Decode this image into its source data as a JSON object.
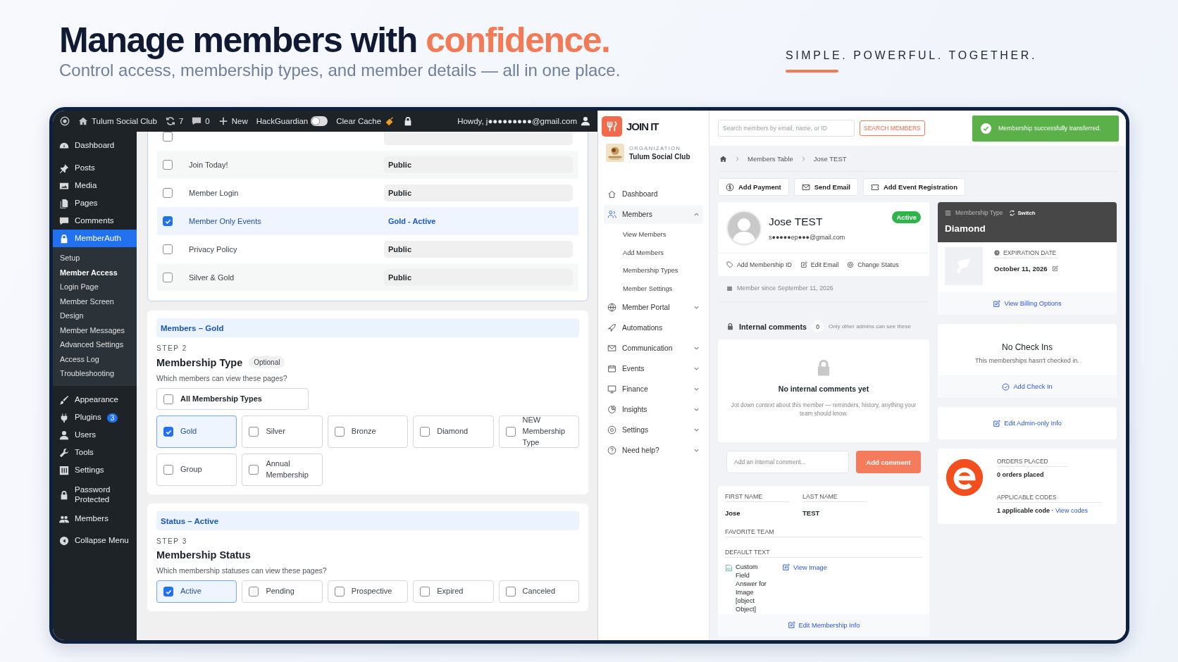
{
  "hero": {
    "title": "Manage members with ",
    "title_accent": "confidence.",
    "subtitle": "Control access, membership types, and member details — all in one place.",
    "tagline": "SIMPLE. POWERFUL. TOGETHER."
  },
  "wp": {
    "admin_bar": {
      "site": "Tulum Social Club",
      "updates": "7",
      "comments": "0",
      "new": "New",
      "plugin": "HackGuardian",
      "plugin_toggle_on": false,
      "cache": "Clear Cache",
      "greeting": "Howdy, j●●●●●●●●●@gmail.com"
    },
    "menu": [
      {
        "label": "Dashboard",
        "selected": false
      },
      {
        "label": "Posts",
        "selected": false
      },
      {
        "label": "Media",
        "selected": false
      },
      {
        "label": "Pages",
        "selected": false
      },
      {
        "label": "Comments",
        "selected": false
      },
      {
        "label": "MemberAuth",
        "selected": true,
        "children": [
          {
            "label": "Setup",
            "selected": false
          },
          {
            "label": "Member Access",
            "selected": true
          },
          {
            "label": "Login Page",
            "selected": false
          },
          {
            "label": "Member Screen",
            "selected": false
          },
          {
            "label": "Design",
            "selected": false
          },
          {
            "label": "Member Messages",
            "selected": false
          },
          {
            "label": "Advanced Settings",
            "selected": false
          },
          {
            "label": "Access Log",
            "selected": false
          },
          {
            "label": "Troubleshooting",
            "selected": false
          }
        ]
      },
      {
        "label": "Appearance",
        "selected": false
      },
      {
        "label": "Plugins",
        "selected": false,
        "badge": "3"
      },
      {
        "label": "Users",
        "selected": false
      },
      {
        "label": "Tools",
        "selected": false
      },
      {
        "label": "Settings",
        "selected": false
      },
      {
        "label": "Password Protected",
        "selected": false
      },
      {
        "label": "Members",
        "selected": false
      },
      {
        "label": "Collapse Menu",
        "selected": false
      }
    ],
    "pages": [
      {
        "checked": false
      },
      {
        "name": "Join Today!",
        "access": "Public",
        "checked": false
      },
      {
        "name": "Member Login",
        "access": "Public",
        "checked": false
      },
      {
        "name": "Member Only Events",
        "access": "Gold - Active",
        "checked": true
      },
      {
        "name": "Privacy Policy",
        "access": "Public",
        "checked": false
      },
      {
        "name": "Silver & Gold",
        "access": "Public",
        "checked": false
      }
    ],
    "sections": [
      {
        "banner": "Members – Gold",
        "step": "STEP 2",
        "title": "Membership Type",
        "tag": "Optional",
        "question": "Which members can view these pages?",
        "all_option": {
          "label": "All Membership Types",
          "checked": false
        },
        "options": [
          {
            "label": "Gold",
            "checked": true
          },
          {
            "label": "Silver",
            "checked": false
          },
          {
            "label": "Bronze",
            "checked": false
          },
          {
            "label": "Diamond",
            "checked": false
          },
          {
            "label": "NEW Membership Type",
            "checked": false
          },
          {
            "label": "Group",
            "checked": false
          },
          {
            "label": "Annual Membership",
            "checked": false
          }
        ]
      },
      {
        "banner": "Status – Active",
        "step": "STEP 3",
        "title": "Membership Status",
        "question": "Which membership statuses can view these pages?",
        "options": [
          {
            "label": "Active",
            "checked": true
          },
          {
            "label": "Pending",
            "checked": false
          },
          {
            "label": "Prospective",
            "checked": false
          },
          {
            "label": "Expired",
            "checked": false
          },
          {
            "label": "Canceled",
            "checked": false
          }
        ]
      }
    ]
  },
  "joinit": {
    "brand": "JOIN IT",
    "org_label": "ORGANIZATION",
    "org_name": "Tulum Social Club",
    "nav": [
      {
        "label": "Dashboard",
        "selected": false
      },
      {
        "label": "Members",
        "selected": true,
        "expanded": true,
        "children": [
          {
            "label": "View Members"
          },
          {
            "label": "Add Members"
          },
          {
            "label": "Membership Types"
          },
          {
            "label": "Member Settings"
          }
        ]
      },
      {
        "label": "Member Portal",
        "selected": false,
        "expanded": false
      },
      {
        "label": "Automations",
        "selected": false
      },
      {
        "label": "Communication",
        "selected": false,
        "expanded": false
      },
      {
        "label": "Events",
        "selected": false,
        "expanded": false
      },
      {
        "label": "Finance",
        "selected": false,
        "expanded": false
      },
      {
        "label": "Insights",
        "selected": false,
        "expanded": false
      },
      {
        "label": "Settings",
        "selected": false,
        "expanded": false
      },
      {
        "label": "Need help?",
        "selected": false,
        "expanded": false
      }
    ],
    "search": {
      "placeholder": "Search members by email, name, or ID",
      "button": "SEARCH MEMBERS"
    },
    "toast": "Membership successfully transferred.",
    "breadcrumb": [
      "Members Table",
      "Jose TEST"
    ],
    "actions": [
      "Add Payment",
      "Send Email",
      "Add Event Registration"
    ],
    "member": {
      "name": "Jose TEST",
      "email": "s●●●●●ep●●●@gmail.com",
      "status": "Active",
      "links": [
        "Add Membership ID",
        "Edit Email",
        "Change Status"
      ],
      "since": "Member since September 11, 2026"
    },
    "comments": {
      "title": "Internal comments",
      "count": "0",
      "note": "Only other admins can see these",
      "empty_title": "No internal comments yet",
      "empty_text": "Jot down context about this member — reminders, history, anything your team should know.",
      "placeholder": "Add an internal comment...",
      "button": "Add comment"
    },
    "fields": {
      "first_label": "FIRST NAME",
      "first": "Jose",
      "last_label": "LAST NAME",
      "last": "TEST",
      "team_label": "FAVORITE TEAM",
      "default_label": "DEFAULT TEXT",
      "default_value": "Custom Field Answer for Image [object Object]",
      "view_image": "View Image",
      "edit": "Edit Membership Info"
    },
    "membership": {
      "label": "Membership Type",
      "switch": "Switch",
      "type": "Diamond",
      "exp_label": "EXPIRATION DATE",
      "exp": "October 11, 2026",
      "billing": "View Billing Options"
    },
    "checkins": {
      "title": "No Check Ins",
      "text": "This memberships hasn't checked in.",
      "add": "Add Check In"
    },
    "admin_info": "Edit Admin-only Info",
    "orders": {
      "label": "ORDERS PLACED",
      "value": "0 orders placed",
      "codes_label": "APPLICABLE CODES",
      "codes": "1 applicable code · ",
      "codes_link": "View codes"
    }
  }
}
